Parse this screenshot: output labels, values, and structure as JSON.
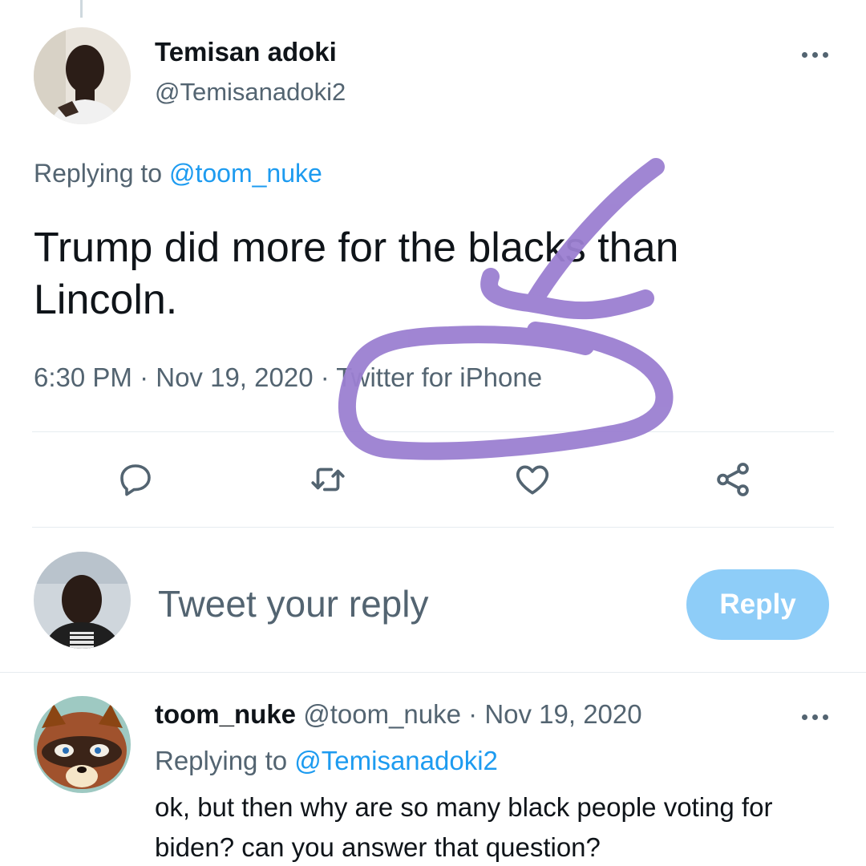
{
  "tweet": {
    "author": {
      "display_name": "Temisan adoki",
      "handle": "@Temisanadoki2"
    },
    "replying_prefix": "Replying to ",
    "replying_to": "@toom_nuke",
    "text": "Trump did more for the blacks than Lincoln.",
    "time": "6:30 PM",
    "date": "Nov 19, 2020",
    "source": "Twitter for iPhone",
    "separator": " · "
  },
  "icons": {
    "more": "more-icon",
    "reply": "reply-icon",
    "retweet": "retweet-icon",
    "like": "like-icon",
    "share": "share-icon"
  },
  "composer": {
    "placeholder": "Tweet your reply",
    "button_label": "Reply"
  },
  "reply": {
    "display_name": "toom_nuke",
    "handle": "@toom_nuke",
    "date": "Nov 19, 2020",
    "replying_prefix": "Replying to ",
    "replying_to": "@Temisanadoki2",
    "text": "ok, but then why are so many black people voting for biden? can you answer that question?"
  },
  "colors": {
    "accent": "#1d9bf0",
    "secondary_text": "#536471",
    "reply_button": "#8ecdf8",
    "annotation": "#9b7fd1"
  }
}
